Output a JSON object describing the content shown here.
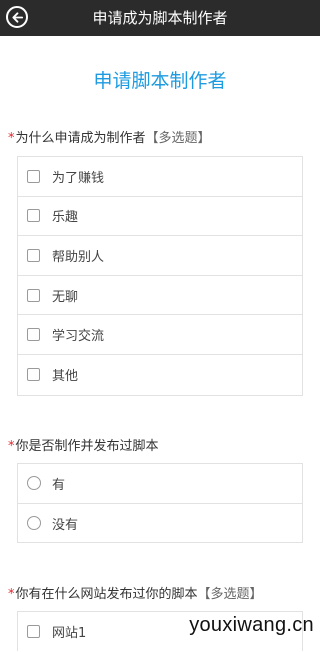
{
  "header": {
    "title": "申请成为脚本制作者",
    "back_icon": "back-arrow-icon"
  },
  "form": {
    "title": "申请脚本制作者"
  },
  "questions": [
    {
      "required_mark": "*",
      "text": "为什么申请成为制作者",
      "tag": "【多选题】",
      "type": "checkbox",
      "options": [
        "为了赚钱",
        "乐趣",
        "帮助别人",
        "无聊",
        "学习交流",
        "其他"
      ]
    },
    {
      "required_mark": "*",
      "text": "你是否制作并发布过脚本",
      "type": "radio",
      "options": [
        "有",
        "没有"
      ]
    },
    {
      "required_mark": "*",
      "text": "你有在什么网站发布过你的脚本",
      "tag": "【多选题】",
      "type": "checkbox",
      "options": [
        "网站1"
      ]
    }
  ],
  "watermark": "youxiwang.cn",
  "colors": {
    "header_bg": "#2b2b2b",
    "title_blue": "#1e9be0",
    "required_red": "#e0282e"
  }
}
